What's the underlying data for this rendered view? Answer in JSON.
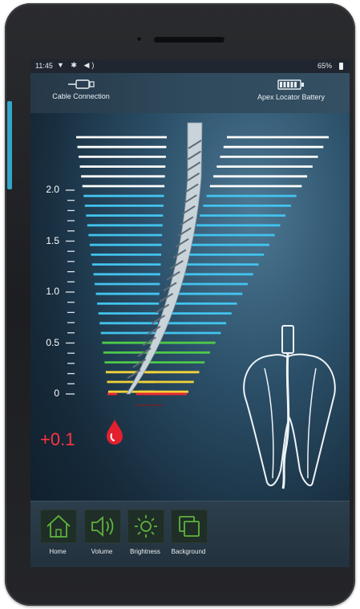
{
  "status": {
    "time": "11:45",
    "icons": "▼ ✱ ◀)",
    "battery": "65%"
  },
  "header": {
    "left": {
      "label": "Cable Connection",
      "icon": "usb-plug-icon"
    },
    "right": {
      "label": "Apex Locator Battery",
      "icon": "battery-icon"
    }
  },
  "scale": {
    "ticks": [
      "2.0",
      "1.5",
      "1.0",
      "0.5",
      "0"
    ]
  },
  "reading": {
    "value": "+0.1",
    "icon": "blood-drop-icon"
  },
  "nav": [
    {
      "label": "Home",
      "icon": "home-icon"
    },
    {
      "label": "Volume",
      "icon": "volume-icon"
    },
    {
      "label": "Brightness",
      "icon": "brightness-icon"
    },
    {
      "label": "Background",
      "icon": "background-icon"
    }
  ],
  "colors": {
    "white": "#ffffff",
    "blue": "#42c3ee",
    "green": "#4cc94a",
    "yellow": "#f1d23a",
    "red": "#e32a34",
    "accent": "#5fb43c"
  }
}
